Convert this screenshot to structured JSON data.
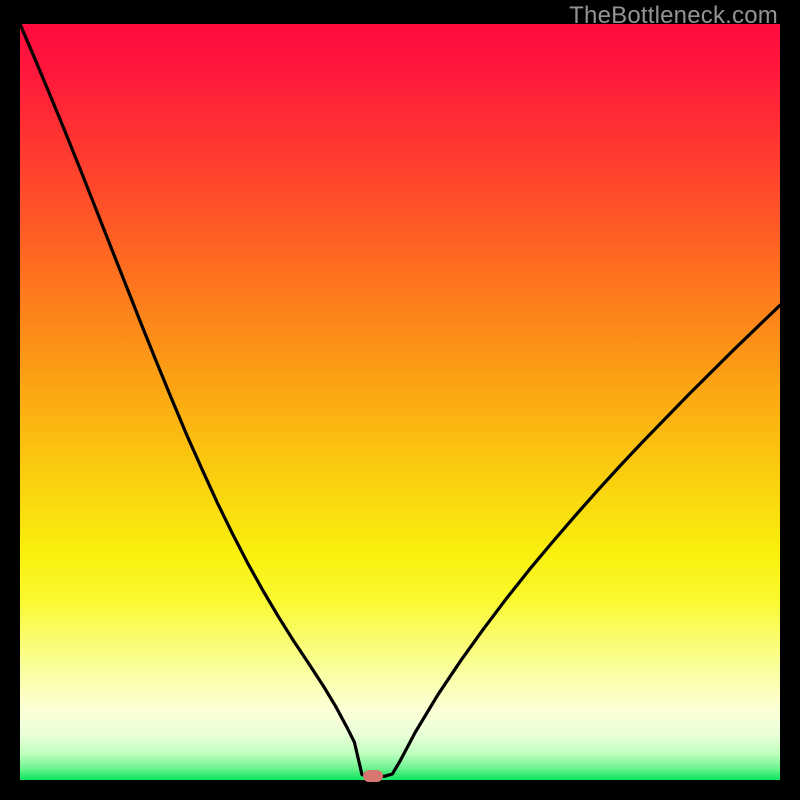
{
  "watermark": "TheBottleneck.com",
  "colors": {
    "frame": "#000000",
    "curve": "#000000",
    "marker": "#d77772",
    "watermark": "#939393"
  },
  "chart_data": {
    "type": "line",
    "title": "",
    "xlabel": "",
    "ylabel": "",
    "xlim": [
      0,
      100
    ],
    "ylim": [
      0,
      100
    ],
    "grid": false,
    "curve_x": [
      0,
      2,
      4,
      6,
      8,
      10,
      12,
      14,
      16,
      18,
      20,
      22,
      24,
      26,
      28,
      30,
      32,
      34,
      36,
      38,
      40,
      41.5,
      43,
      44,
      45,
      46,
      47,
      48,
      49,
      50,
      52,
      55,
      58,
      61,
      64,
      67,
      70,
      73,
      76,
      79,
      82,
      85,
      88,
      91,
      94,
      97,
      100
    ],
    "curve_y": [
      100,
      95.3,
      90.5,
      85.6,
      80.6,
      75.5,
      70.4,
      65.3,
      60.2,
      55.2,
      50.3,
      45.5,
      41,
      36.6,
      32.5,
      28.6,
      25,
      21.6,
      18.4,
      15.4,
      12.3,
      9.8,
      7,
      5,
      0.7,
      0.5,
      0.5,
      0.5,
      0.8,
      2.5,
      6.3,
      11.3,
      15.8,
      20,
      24,
      27.8,
      31.4,
      34.9,
      38.3,
      41.6,
      44.8,
      47.9,
      51,
      54,
      57,
      59.9,
      62.8
    ],
    "marker": {
      "x": 46.5,
      "y": 0.5
    },
    "background_gradient_stops": [
      {
        "pos": 0,
        "color": "#ff0b3e"
      },
      {
        "pos": 0.7,
        "color": "#f9f00e"
      },
      {
        "pos": 1.0,
        "color": "#0ae55f"
      }
    ],
    "notes": "No axis ticks, labels, or legend are visible. X and Y values are normalized 0-100 estimates read from curve geometry; curve shows a steep descent from upper-left, a minimum near x≈46 touching the bottom band, then rising toward right. Background is a vertical red→yellow→green gradient inside a black frame."
  }
}
